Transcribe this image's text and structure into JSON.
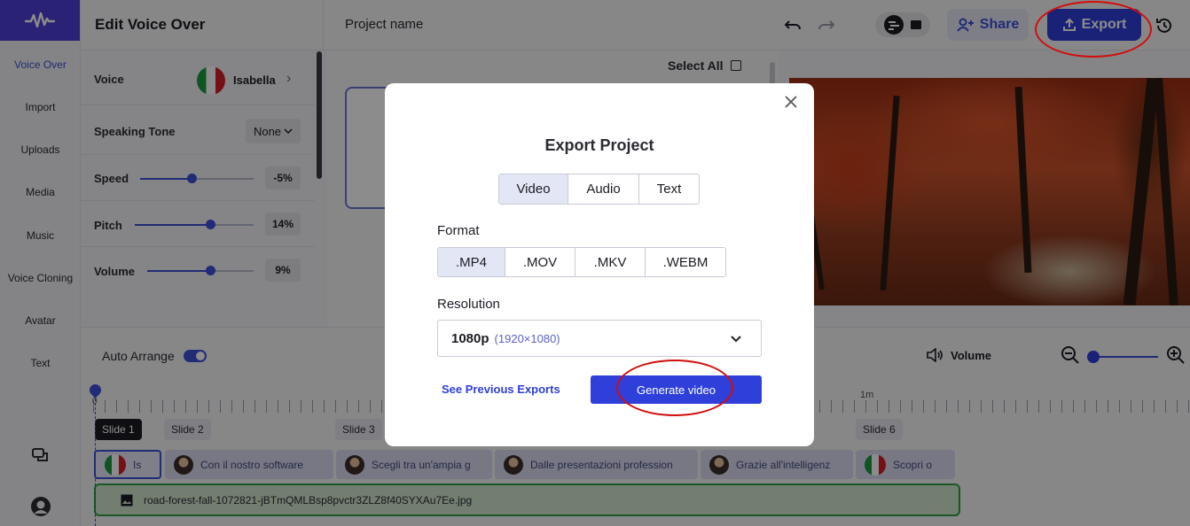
{
  "rail": {
    "items": [
      {
        "label": "Voice Over"
      },
      {
        "label": "Import"
      },
      {
        "label": "Uploads"
      },
      {
        "label": "Media"
      },
      {
        "label": "Music"
      },
      {
        "label": "Voice Cloning"
      },
      {
        "label": "Avatar"
      },
      {
        "label": "Text"
      }
    ]
  },
  "header": {
    "panel_title": "Edit Voice Over",
    "project_name": "Project name",
    "share_label": "Share",
    "export_label": "Export"
  },
  "voice_panel": {
    "voice_label": "Voice",
    "voice_name": "Isabella",
    "tone_label": "Speaking Tone",
    "tone_value": "None",
    "speed_label": "Speed",
    "speed_value": "-5%",
    "pitch_label": "Pitch",
    "pitch_value": "14%",
    "volume_label": "Volume",
    "volume_value": "9%"
  },
  "slides_area": {
    "select_all_label": "Select All"
  },
  "timeline": {
    "auto_arrange_label": "Auto Arrange",
    "volume_label": "Volume",
    "time_marker": "1m",
    "start_marker": "0",
    "slides": [
      "Slide 1",
      "Slide 2",
      "Slide 3",
      "Slide 6"
    ],
    "voiceover_clips": [
      "Is",
      "Con il nostro software",
      "Scegli tra un'ampia g",
      "Dalle presentazioni profession",
      "Grazie all'intelligenz",
      "Scopri o"
    ],
    "image_clip": "road-forest-fall-1072821-jBTmQMLBsp8pvctr3ZLZ8f40SYXAu7Ee.jpg"
  },
  "modal": {
    "title": "Export Project",
    "tabs": [
      "Video",
      "Audio",
      "Text"
    ],
    "format_label": "Format",
    "formats": [
      ".MP4",
      ".MOV",
      ".MKV",
      ".WEBM"
    ],
    "resolution_label": "Resolution",
    "resolution_value": "1080p",
    "resolution_detail": "(1920×1080)",
    "see_previous_label": "See Previous Exports",
    "generate_label": "Generate video"
  },
  "colors": {
    "accent": "#2f3fd9",
    "highlight_ring": "#d20d0d"
  }
}
